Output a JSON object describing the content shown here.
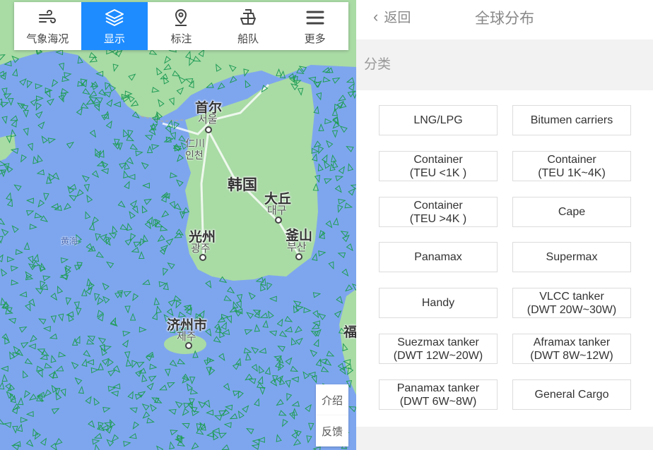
{
  "toolbar": {
    "items": [
      {
        "label": "气象海况",
        "icon": "wind-icon"
      },
      {
        "label": "显示",
        "icon": "layers-icon",
        "active": true
      },
      {
        "label": "标注",
        "icon": "map-pin-icon"
      },
      {
        "label": "船队",
        "icon": "ship-icon"
      },
      {
        "label": "更多",
        "icon": "menu-icon"
      }
    ]
  },
  "map": {
    "labels": {
      "seoul_cn": "首尔",
      "seoul_kr": "서울",
      "incheon_cn": "仁川",
      "incheon_kr": "인천",
      "korea": "韩国",
      "daegu_cn": "大丘",
      "daegu_kr": "대구",
      "gwangju_cn": "光州",
      "gwangju_kr": "광주",
      "busan_cn": "釜山",
      "busan_kr": "부산",
      "jeju_cn": "济州市",
      "jeju_kr": "제주",
      "yellow_sea": "黄海",
      "fu": "福"
    },
    "side_buttons": {
      "intro": "介绍",
      "feedback": "反馈"
    },
    "colors": {
      "sea": "#7ea6ee",
      "land": "#a9dba5",
      "ships": "#1f9d55"
    }
  },
  "panel": {
    "back_label": "返回",
    "title": "全球分布",
    "section_label": "分类",
    "categories": [
      "LNG/LPG",
      "Bitumen carriers",
      "Container\n(TEU <1K )",
      "Container\n(TEU 1K~4K)",
      "Container\n(TEU >4K )",
      "Cape",
      "Panamax",
      "Supermax",
      "Handy",
      "VLCC tanker\n(DWT 20W~30W)",
      "Suezmax tanker\n(DWT 12W~20W)",
      "Aframax tanker\n(DWT 8W~12W)",
      "Panamax tanker\n(DWT 6W~8W)",
      "General Cargo"
    ]
  }
}
